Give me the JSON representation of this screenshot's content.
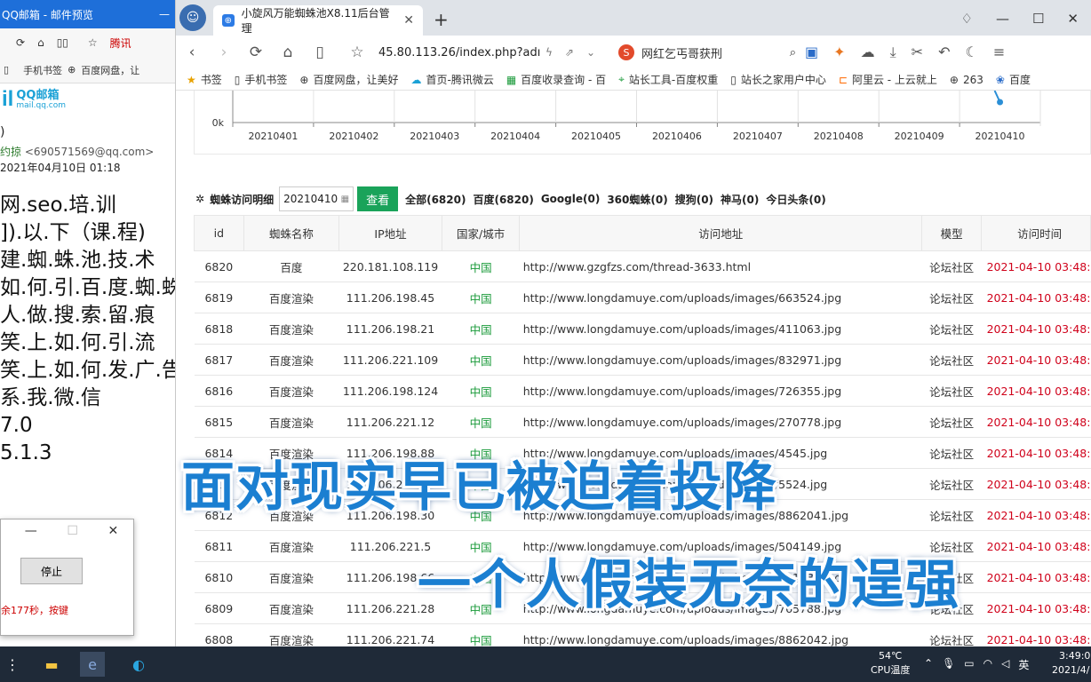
{
  "left_window": {
    "title": "QQ邮箱 - 邮件预览",
    "nav_link": "腾讯",
    "bookmarks": [
      "手机书签",
      "百度网盘，让"
    ],
    "logo_big": "il",
    "logo_text": "QQ邮箱",
    "logo_sub": "mail.qq.com",
    "number_fragment": ")",
    "sender_fragment": "约掠",
    "sender_email": "<690571569@qq.com>",
    "date": "2021年04月10日 01:18",
    "body_lines": [
      "网.seo.培.训",
      "]).以.下（课.程)",
      "建.蜘.蛛.池.技.术",
      "如.何.引.百.度.蜘.蛛)",
      "人.做.搜.索.留.痕",
      "笑.上.如.何.引.流",
      "笑.上.如.何.发.广.告",
      "系.我.微.信",
      "7.0",
      "5.1.3"
    ]
  },
  "dialog": {
    "stop_button": "停止",
    "message": "余177秒，按键"
  },
  "browser": {
    "tab_title": "小旋风万能蜘蛛池X8.11后台管理",
    "url": "45.80.113.26/index.php?adı",
    "search_text": "网红乞丐哥获刑",
    "bookmarks": [
      "书签",
      "手机书签",
      "百度网盘，让美好",
      "首页-腾讯微云",
      "百度收录查询 - 百",
      "站长工具-百度权重",
      "站长之家用户中心",
      "阿里云 - 上云就上",
      "263",
      "百度"
    ]
  },
  "chart_data": {
    "type": "line",
    "categories": [
      "20210401",
      "20210402",
      "20210403",
      "20210404",
      "20210405",
      "20210406",
      "20210407",
      "20210408",
      "20210409",
      "20210410"
    ],
    "y_tick_label": "0k",
    "grid": true
  },
  "filter": {
    "title": "蜘蛛访问明细",
    "date_value": "20210410",
    "button": "查看",
    "stats": [
      "全部(6820)",
      "百度(6820)",
      "Google(0)",
      "360蜘蛛(0)",
      "搜狗(0)",
      "神马(0)",
      "今日头条(0)"
    ]
  },
  "table": {
    "headers": [
      "id",
      "蜘蛛名称",
      "IP地址",
      "国家/城市",
      "访问地址",
      "模型",
      "访问时间"
    ],
    "rows": [
      [
        "6820",
        "百度",
        "220.181.108.119",
        "中国",
        "http://www.gzgfzs.com/thread-3633.html",
        "论坛社区",
        "2021-04-10 03:48:"
      ],
      [
        "6819",
        "百度渲染",
        "111.206.198.45",
        "中国",
        "http://www.longdamuye.com/uploads/images/663524.jpg",
        "论坛社区",
        "2021-04-10 03:48:"
      ],
      [
        "6818",
        "百度渲染",
        "111.206.198.21",
        "中国",
        "http://www.longdamuye.com/uploads/images/411063.jpg",
        "论坛社区",
        "2021-04-10 03:48:"
      ],
      [
        "6817",
        "百度渲染",
        "111.206.221.109",
        "中国",
        "http://www.longdamuye.com/uploads/images/832971.jpg",
        "论坛社区",
        "2021-04-10 03:48:"
      ],
      [
        "6816",
        "百度渲染",
        "111.206.198.124",
        "中国",
        "http://www.longdamuye.com/uploads/images/726355.jpg",
        "论坛社区",
        "2021-04-10 03:48:"
      ],
      [
        "6815",
        "百度渲染",
        "111.206.221.12",
        "中国",
        "http://www.longdamuye.com/uploads/images/270778.jpg",
        "论坛社区",
        "2021-04-10 03:48:"
      ],
      [
        "6814",
        "百度渲染",
        "111.206.198.88",
        "中国",
        "http://www.longdamuye.com/uploads/images/4545.jpg",
        "论坛社区",
        "2021-04-10 03:48:"
      ],
      [
        "6813",
        "百度渲染",
        "111.206.221.86",
        "中国",
        "http://www.longdamuye.com/uploads/images/5524.jpg",
        "论坛社区",
        "2021-04-10 03:48:"
      ],
      [
        "6812",
        "百度渲染",
        "111.206.198.30",
        "中国",
        "http://www.longdamuye.com/uploads/images/8862041.jpg",
        "论坛社区",
        "2021-04-10 03:48:"
      ],
      [
        "6811",
        "百度渲染",
        "111.206.221.5",
        "中国",
        "http://www.longdamuye.com/uploads/images/504149.jpg",
        "论坛社区",
        "2021-04-10 03:48:"
      ],
      [
        "6810",
        "百度渲染",
        "111.206.198.66",
        "中国",
        "http://www.longdamuye.com/uploads/images/431989.jpg",
        "论坛社区",
        "2021-04-10 03:48:"
      ],
      [
        "6809",
        "百度渲染",
        "111.206.221.28",
        "中国",
        "http://www.longdamuye.com/uploads/images/765788.jpg",
        "论坛社区",
        "2021-04-10 03:48:"
      ],
      [
        "6808",
        "百度渲染",
        "111.206.221.74",
        "中国",
        "http://www.longdamuye.com/uploads/images/8862042.jpg",
        "论坛社区",
        "2021-04-10 03:48:"
      ]
    ]
  },
  "overlay": {
    "line1": "面对现实早已被迫着投降",
    "line2": "一个人假装无奈的逞强"
  },
  "taskbar": {
    "temp": "54℃",
    "temp_label": "CPU温度",
    "ime": "英",
    "time": "3:49:0",
    "date": "2021/4/"
  },
  "colors": {
    "accent_blue": "#1e6fd9",
    "go_green": "#1aa35a",
    "country_green": "#1a9a3a",
    "time_red": "#d0021b",
    "caption_blue": "#1b7fd1"
  }
}
